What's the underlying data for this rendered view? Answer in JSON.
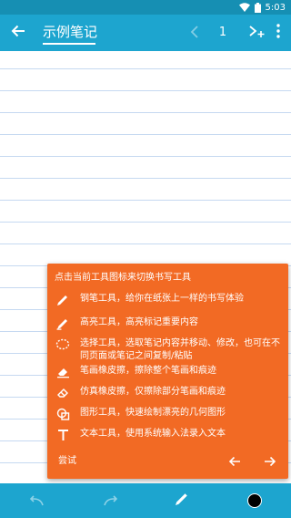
{
  "status_bar": {
    "time": "5:03",
    "wifi_icon": "wifi-icon",
    "battery_icon": "battery-icon"
  },
  "app_bar": {
    "back_icon": "arrow-back-icon",
    "title": "示例笔记",
    "prev_icon": "chevron-left-icon",
    "page_number": "1",
    "add_page_icon": "add-page-icon",
    "more_icon": "more-vert-icon"
  },
  "tip": {
    "header": "点击当前工具图标来切换书写工具",
    "items": [
      {
        "icon": "pen-icon",
        "text": "钢笔工具，给你在纸张上一样的书写体验"
      },
      {
        "icon": "highlighter-icon",
        "text": "高亮工具，高亮标记重要内容"
      },
      {
        "icon": "lasso-icon",
        "text": "选择工具，选取笔记内容并移动、修改，也可在不同页面或笔记之间复制/粘贴"
      },
      {
        "icon": "stroke-eraser-icon",
        "text": "笔画橡皮擦，擦除整个笔画和痕迹"
      },
      {
        "icon": "partial-eraser-icon",
        "text": "仿真橡皮擦，仅擦除部分笔画和痕迹"
      },
      {
        "icon": "shape-icon",
        "text": "图形工具，快速绘制漂亮的几何图形"
      },
      {
        "icon": "text-icon",
        "text": "文本工具，使用系统输入法录入文本"
      }
    ],
    "try_label": "尝试",
    "prev_icon": "arrow-left-icon",
    "next_icon": "arrow-right-icon"
  },
  "bottom_bar": {
    "undo_icon": "undo-icon",
    "redo_icon": "redo-icon",
    "pen_icon": "pen-icon",
    "color_icon": "color-picker-icon",
    "current_color": "#000000"
  },
  "colors": {
    "primary": "#1da5cf",
    "status_bar": "#168fb3",
    "tip_card": "#f26a24",
    "line": "#c6d9f1"
  }
}
